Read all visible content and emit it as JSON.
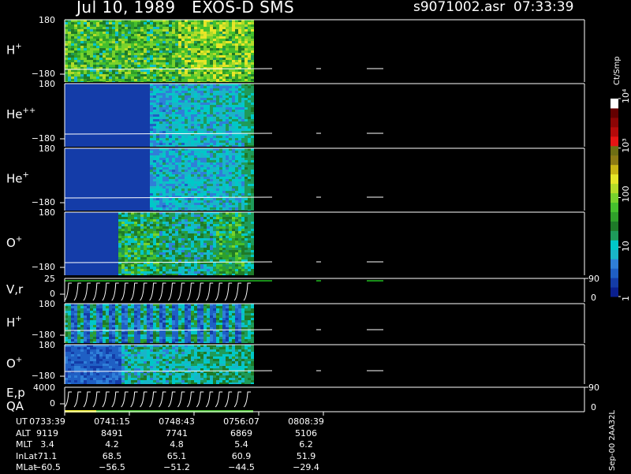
{
  "header": {
    "title": "Jul 10, 1989   EXOS-D SMS",
    "file": "s9071002.asr  07:33:39"
  },
  "footer": "Sep-00  2AA32L",
  "colorbar": {
    "title": "Ct/Smp",
    "ticks": [
      "1",
      "10",
      "100",
      "10³",
      "10⁴"
    ],
    "colors": [
      "#0a1f8f",
      "#143ca8",
      "#1f5fc4",
      "#2f7fd8",
      "#19b5c8",
      "#00c8c8",
      "#1e9b5a",
      "#1e7a28",
      "#2fa02a",
      "#45c02d",
      "#78d22c",
      "#b4dc28",
      "#e6e628",
      "#c8b414",
      "#8c7a14",
      "#6e6e14",
      "#e61414",
      "#b40a0a",
      "#8c0505",
      "#640000",
      "#ffffff"
    ]
  },
  "panels": [
    {
      "name": "H",
      "sup": "+",
      "top": "180",
      "bottom": "−180",
      "right": ""
    },
    {
      "name": "He",
      "sup": "++",
      "top": "180",
      "bottom": "−180",
      "right": ""
    },
    {
      "name": "He",
      "sup": "+",
      "top": "180",
      "bottom": "−180",
      "right": ""
    },
    {
      "name": "O",
      "sup": "+",
      "top": "180",
      "bottom": "−180",
      "right": ""
    },
    {
      "name": "V,r",
      "sup": "",
      "top": "25",
      "bottom": "0",
      "right_top": "90",
      "right_bottom": "0"
    },
    {
      "name": "H",
      "sup": "+",
      "top": "180",
      "bottom": "−180",
      "right": ""
    },
    {
      "name": "O",
      "sup": "+",
      "top": "180",
      "bottom": "−180",
      "right": ""
    },
    {
      "name": "E,p",
      "sup": "",
      "name2": "QA",
      "top": "4000",
      "bottom": "0",
      "right_top": "90",
      "right_bottom": "0"
    }
  ],
  "ephemeris": {
    "labels": [
      "UT",
      "ALT",
      "MLT",
      "InLat",
      "MLat"
    ],
    "columns": [
      [
        "0733:39",
        "9119",
        "3.4",
        "71.1",
        "−60.5"
      ],
      [
        "0741:15",
        "8491",
        "4.2",
        "68.5",
        "−56.5"
      ],
      [
        "0748:43",
        "7741",
        "4.8",
        "65.1",
        "−51.2"
      ],
      [
        "0756:07",
        "6869",
        "5.4",
        "60.9",
        "−44.5"
      ],
      [
        "0808:39",
        "5106",
        "6.2",
        "51.9",
        "−29.4"
      ]
    ]
  },
  "chart_data": {
    "type": "heatmap",
    "title": "Jul 10, 1989   EXOS-D SMS",
    "x": [
      "0733:39",
      "0741:15",
      "0748:43",
      "0756:07",
      "0808:39"
    ],
    "series": [
      {
        "name": "H+",
        "ylim": [
          -180,
          180
        ]
      },
      {
        "name": "He++",
        "ylim": [
          -180,
          180
        ]
      },
      {
        "name": "He+",
        "ylim": [
          -180,
          180
        ]
      },
      {
        "name": "O+",
        "ylim": [
          -180,
          180
        ]
      },
      {
        "name": "V,r",
        "ylim": [
          0,
          25
        ]
      },
      {
        "name": "H+",
        "ylim": [
          -180,
          180
        ]
      },
      {
        "name": "O+",
        "ylim": [
          -180,
          180
        ]
      },
      {
        "name": "E,p",
        "ylim": [
          0,
          4000
        ]
      }
    ],
    "colorscale": "log",
    "zlim": [
      1,
      10000
    ]
  }
}
